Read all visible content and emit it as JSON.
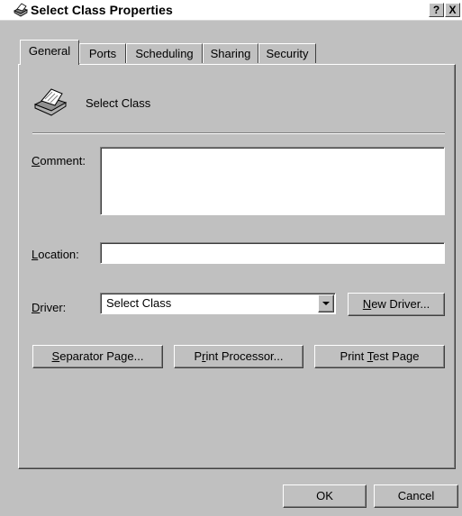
{
  "window": {
    "title": "Select Class Properties"
  },
  "titlebar_buttons": {
    "help": "?",
    "close": "X"
  },
  "tabs": [
    {
      "label": "General",
      "active": true
    },
    {
      "label": "Ports",
      "active": false
    },
    {
      "label": "Scheduling",
      "active": false
    },
    {
      "label": "Sharing",
      "active": false
    },
    {
      "label": "Security",
      "active": false
    }
  ],
  "general": {
    "printer_name": "Select Class",
    "comment": {
      "label_prefix": "",
      "label_mnemonic": "C",
      "label_rest": "omment:",
      "value": ""
    },
    "location": {
      "label_mnemonic": "L",
      "label_rest": "ocation:",
      "value": ""
    },
    "driver": {
      "label_mnemonic": "D",
      "label_rest": "river:",
      "selected": "Select Class"
    },
    "new_driver": {
      "mnemonic": "N",
      "rest": "ew Driver..."
    },
    "separator_page": {
      "mnemonic": "S",
      "rest": "eparator Page..."
    },
    "print_processor": {
      "pre": "P",
      "mnemonic": "r",
      "rest": "int Processor..."
    },
    "print_test_page": {
      "pre": "Print ",
      "mnemonic": "T",
      "rest": "est Page"
    }
  },
  "footer": {
    "ok": "OK",
    "cancel": "Cancel"
  },
  "colors": {
    "face": "#c0c0c0",
    "shadow": "#808080",
    "highlight": "#ffffff",
    "dark": "#404040"
  }
}
